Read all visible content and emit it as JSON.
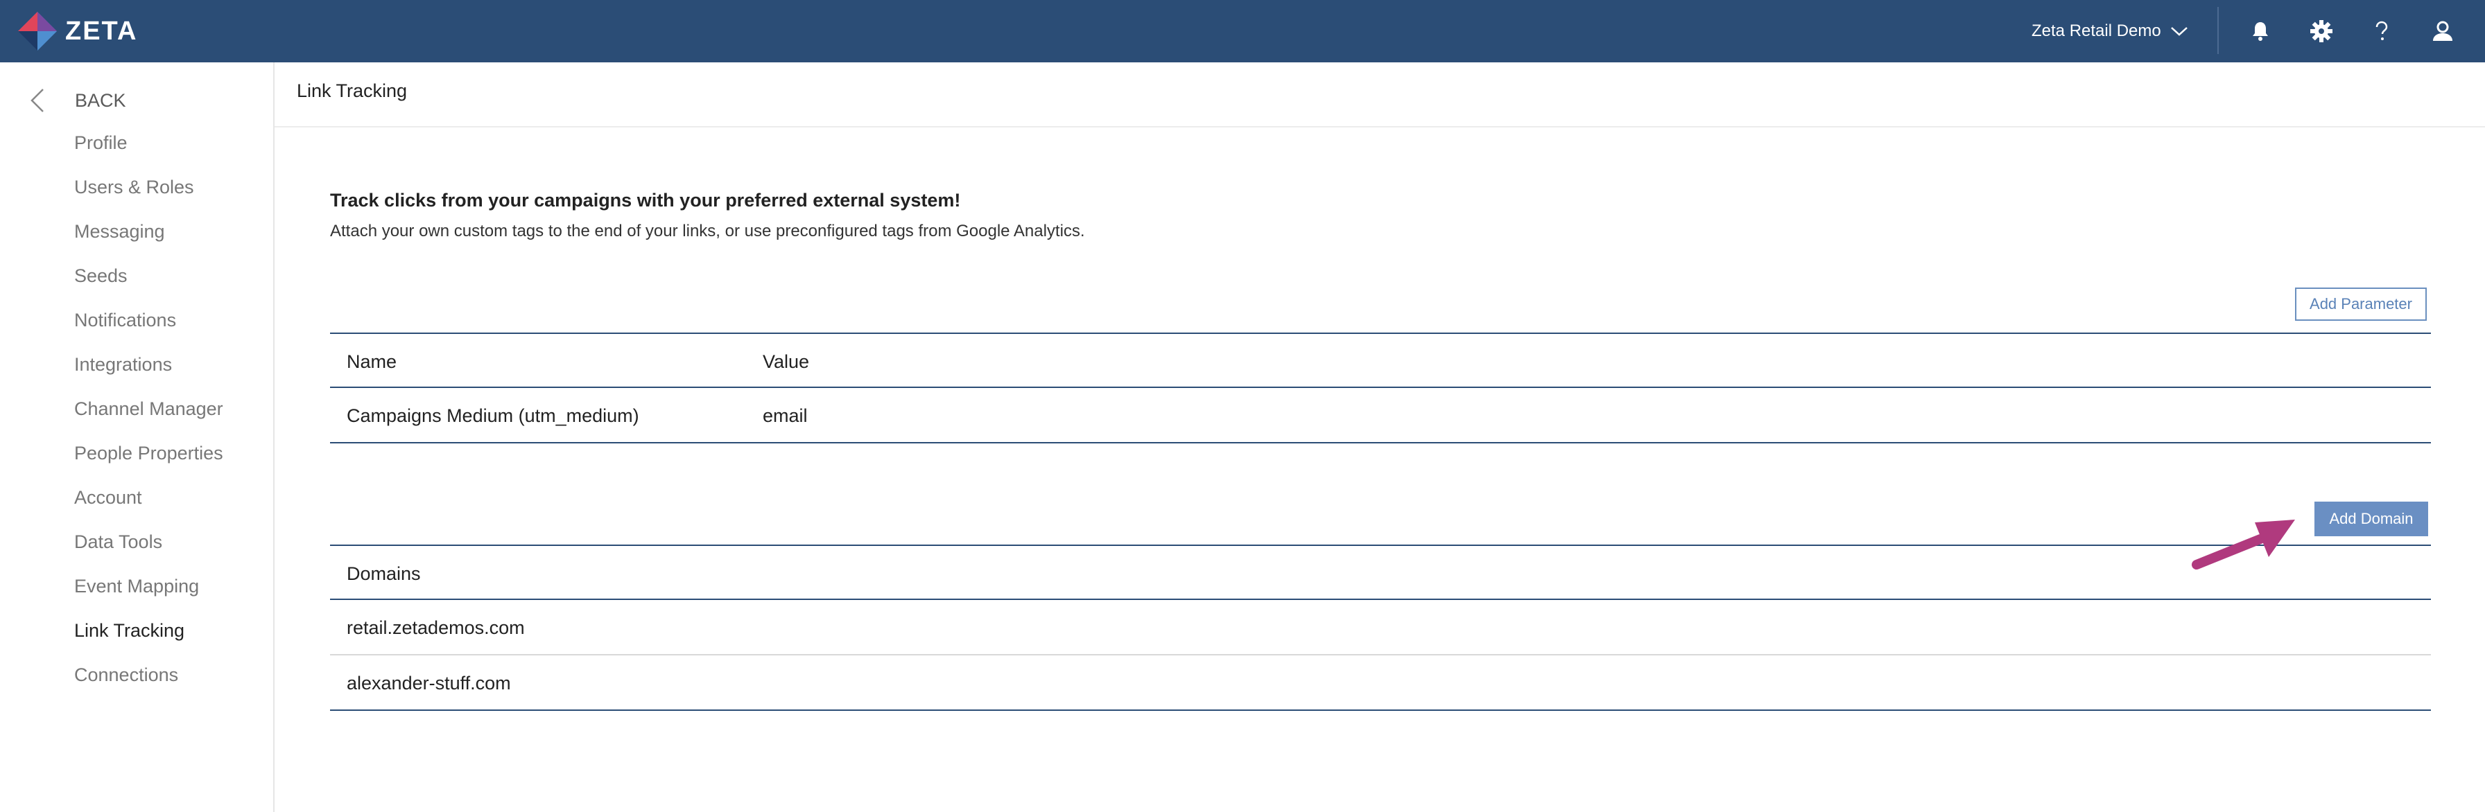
{
  "app": {
    "logo_text": "ZETA"
  },
  "header": {
    "account_name": "Zeta Retail Demo",
    "icons": [
      "bell-icon",
      "gear-icon",
      "help-icon",
      "user-icon"
    ]
  },
  "sidebar": {
    "back_label": "BACK",
    "items": [
      {
        "label": "Profile"
      },
      {
        "label": "Users & Roles"
      },
      {
        "label": "Messaging"
      },
      {
        "label": "Seeds"
      },
      {
        "label": "Notifications"
      },
      {
        "label": "Integrations"
      },
      {
        "label": "Channel Manager"
      },
      {
        "label": "People Properties"
      },
      {
        "label": "Account"
      },
      {
        "label": "Data Tools"
      },
      {
        "label": "Event Mapping"
      },
      {
        "label": "Link Tracking"
      },
      {
        "label": "Connections"
      }
    ],
    "active_item": "Link Tracking"
  },
  "main": {
    "page_title": "Link Tracking",
    "intro_title": "Track clicks from your campaigns with your preferred external system!",
    "intro_desc": "Attach your own custom tags to the end of your links, or use preconfigured tags from Google Analytics.",
    "add_parameter_label": "Add Parameter",
    "params_table": {
      "columns": [
        "Name",
        "Value"
      ],
      "rows": [
        {
          "name": "Campaigns Medium (utm_medium)",
          "value": "email"
        }
      ]
    },
    "add_domain_label": "Add Domain",
    "domains_table": {
      "column": "Domains",
      "rows": [
        "retail.zetademos.com",
        "alexander-stuff.com"
      ]
    }
  },
  "colors": {
    "topbar": "#2b4d76",
    "accent": "#6a8fc3",
    "annotation_arrow": "#b03a7e"
  }
}
